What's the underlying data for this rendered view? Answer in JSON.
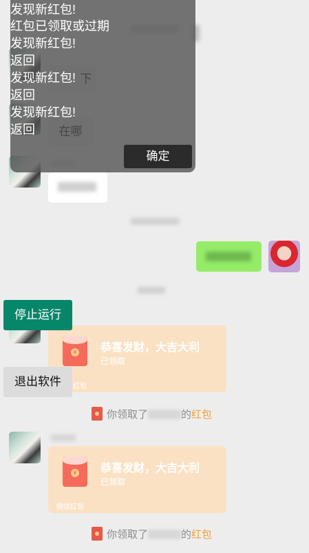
{
  "overlay_log": [
    "发现新红包!",
    "红包已领取或过期",
    "发现新红包!",
    "返回",
    "发现新红包!",
    "返回",
    "发现新红包!",
    "返回"
  ],
  "overlay": {
    "confirm_label": "确定"
  },
  "chat": {
    "partial_words": [
      "下",
      "在哪"
    ]
  },
  "floating": {
    "stop_label": "停止运行",
    "exit_label": "退出软件"
  },
  "red_packets": [
    {
      "title": "恭喜发财，大吉大利",
      "status": "已领取",
      "footer": "红包"
    },
    {
      "title": "恭喜发财，大吉大利",
      "status": "已领取",
      "footer": "微信红包"
    }
  ],
  "notices": [
    {
      "prefix": "你领取了",
      "mid": "的",
      "highlight": "红包"
    },
    {
      "prefix": "你领取了",
      "mid": "的",
      "highlight": "红包"
    }
  ],
  "colors": {
    "stop_button": "#07876a",
    "red_packet_bg": "#fbe1c4",
    "sent_bubble": "#95ec69",
    "highlight": "#f0a43b"
  }
}
